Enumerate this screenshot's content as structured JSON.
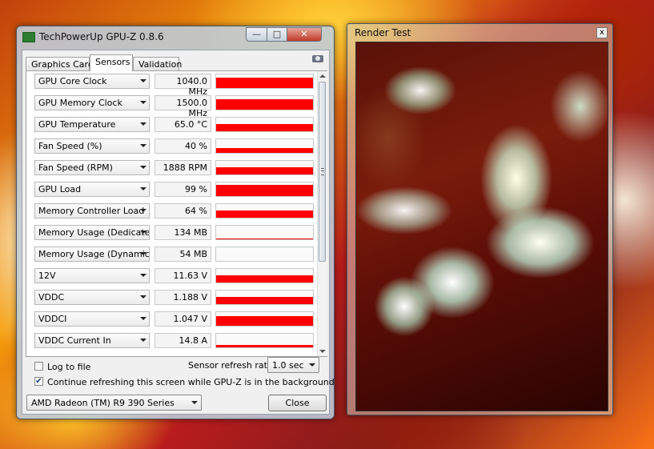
{
  "gpuz": {
    "title": "TechPowerUp GPU-Z 0.8.6",
    "window_buttons": {
      "minimize": "—",
      "maximize": "□",
      "close": "✕"
    },
    "tabs": [
      {
        "label": "Graphics Card",
        "active": false
      },
      {
        "label": "Sensors",
        "active": true
      },
      {
        "label": "Validation",
        "active": false
      }
    ],
    "sensors": [
      {
        "name": "GPU Core Clock",
        "value": "1040.0 MHz",
        "graph_level": 0.75
      },
      {
        "name": "GPU Memory Clock",
        "value": "1500.0 MHz",
        "graph_level": 0.75
      },
      {
        "name": "GPU Temperature",
        "value": "65.0 °C",
        "graph_level": 0.5
      },
      {
        "name": "Fan Speed (%)",
        "value": "40 %",
        "graph_level": 0.35
      },
      {
        "name": "Fan Speed (RPM)",
        "value": "1888 RPM",
        "graph_level": 0.55
      },
      {
        "name": "GPU Load",
        "value": "99 %",
        "graph_level": 0.85
      },
      {
        "name": "Memory Controller Load",
        "value": "64 %",
        "graph_level": 0.55
      },
      {
        "name": "Memory Usage (Dedicated)",
        "value": "134 MB",
        "graph_level": 0.06
      },
      {
        "name": "Memory Usage (Dynamic)",
        "value": "54 MB",
        "graph_level": 0.0
      },
      {
        "name": "12V",
        "value": "11.63 V",
        "graph_level": 0.55
      },
      {
        "name": "VDDC",
        "value": "1.188 V",
        "graph_level": 0.55
      },
      {
        "name": "VDDCI",
        "value": "1.047 V",
        "graph_level": 0.7
      },
      {
        "name": "VDDC Current In",
        "value": "14.8 A",
        "graph_level": 0.15
      }
    ],
    "log_to_file": {
      "label": "Log to file",
      "checked": false
    },
    "refresh_label": "Sensor refresh rate:",
    "refresh_value": "1.0 sec",
    "continue_refresh": {
      "label": "Continue refreshing this screen while GPU-Z is in the background",
      "checked": true
    },
    "gpu_select": "AMD Radeon (TM) R9 390 Series",
    "close_button": "Close",
    "graph_color": "#ff0000"
  },
  "render_test": {
    "title": "Render Test",
    "close_glyph": "x"
  }
}
